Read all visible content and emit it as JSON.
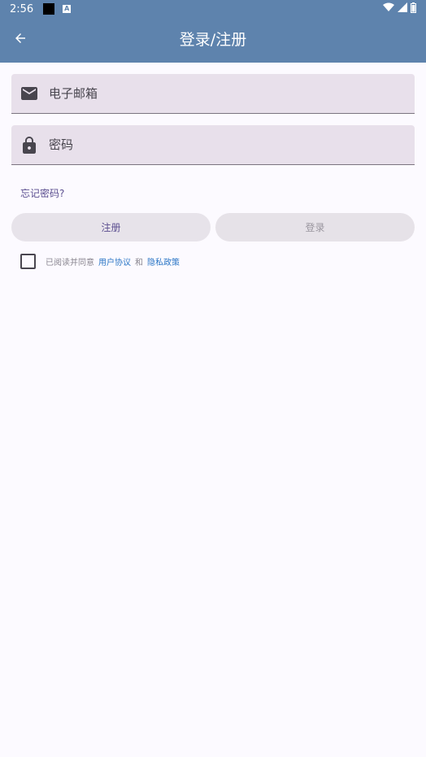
{
  "status_bar": {
    "time": "2:56",
    "icons": [
      "notification-square-icon",
      "a-badge-icon",
      "wifi-icon",
      "signal-icon",
      "battery-icon"
    ]
  },
  "app_bar": {
    "title": "登录/注册",
    "back_icon": "arrow-back-icon"
  },
  "form": {
    "email": {
      "placeholder": "电子邮箱",
      "value": "",
      "icon": "mail-icon"
    },
    "password": {
      "placeholder": "密码",
      "value": "",
      "icon": "lock-icon"
    },
    "forgot_password": "忘记密码?"
  },
  "buttons": {
    "register": "注册",
    "login": "登录"
  },
  "agreement": {
    "prefix": "已阅读并同意",
    "user_agreement": "用户协议",
    "and": "和",
    "privacy_policy": "隐私政策",
    "checked": false
  },
  "colors": {
    "app_bar": "#5e83ad",
    "field_bg": "#e8e0eb",
    "link": "#2c76c6",
    "accent_text": "#5c4f90",
    "page_bg": "#fcfaff"
  }
}
